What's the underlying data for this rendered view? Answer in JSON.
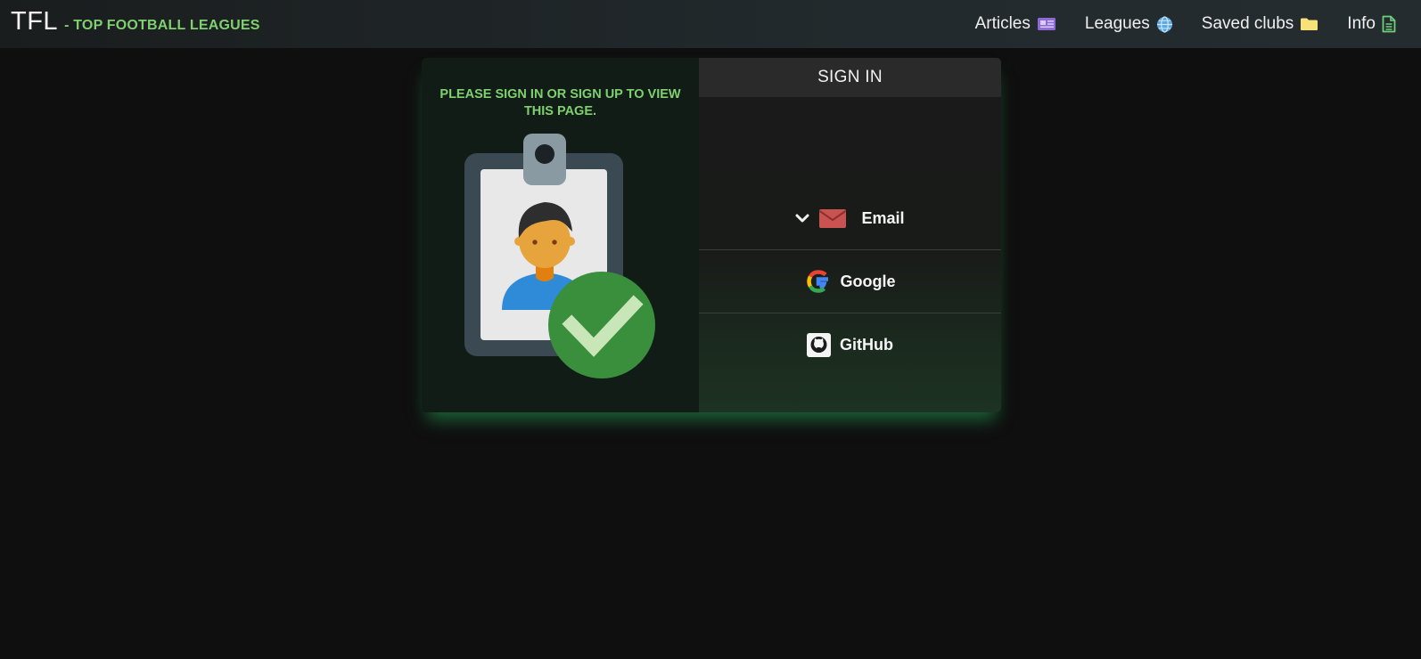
{
  "brand": {
    "title": "TFL",
    "subtitle": "- TOP FOOTBALL LEAGUES"
  },
  "nav": {
    "items": [
      {
        "label": "Articles",
        "icon": "newspaper-icon"
      },
      {
        "label": "Leagues",
        "icon": "globe-icon"
      },
      {
        "label": "Saved clubs",
        "icon": "folder-icon"
      },
      {
        "label": "Info",
        "icon": "document-icon"
      }
    ]
  },
  "left": {
    "message": "PLEASE SIGN IN OR SIGN UP TO VIEW THIS PAGE."
  },
  "signin": {
    "title": "SIGN IN",
    "providers": [
      {
        "label": "Email",
        "icon": "envelope-icon"
      },
      {
        "label": "Google",
        "icon": "google-icon"
      },
      {
        "label": "GitHub",
        "icon": "github-icon"
      }
    ]
  },
  "colors": {
    "accent": "#7fd06e",
    "background": "#0f0f0f",
    "glow": "#28aa5a"
  }
}
